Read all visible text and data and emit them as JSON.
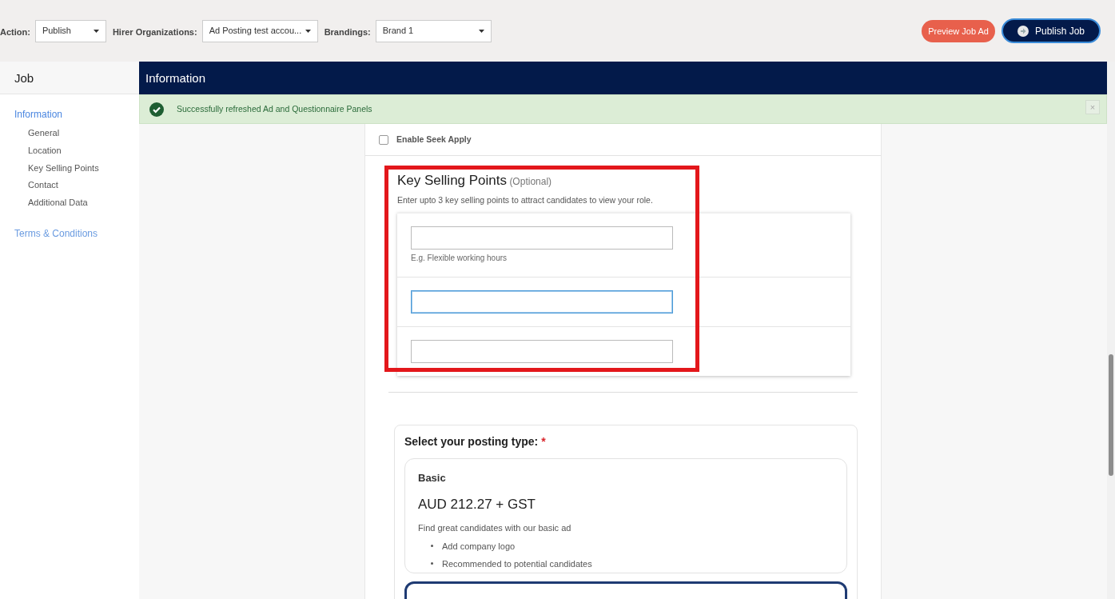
{
  "toolbar": {
    "fields": [
      {
        "label": "Action:",
        "value": "Publish"
      },
      {
        "label": "Hirer Organizations:",
        "value": "Ad Posting test accou..."
      },
      {
        "label": "Brandings:",
        "value": "Brand 1"
      }
    ],
    "buttons": [
      {
        "label": "Preview Job Ad",
        "kind": "secondary"
      },
      {
        "label": "Publish Job",
        "kind": "primary"
      }
    ]
  },
  "sidebar": {
    "title": "Job",
    "items": [
      {
        "label": "Information",
        "selected": true,
        "children": [
          {
            "label": "General"
          },
          {
            "label": "Location"
          },
          {
            "label": "Key Selling Points"
          },
          {
            "label": "Contact"
          },
          {
            "label": "Additional Data"
          }
        ]
      },
      {
        "label": "Terms & Conditions",
        "selected": false
      }
    ]
  },
  "header": {
    "title": "Information"
  },
  "alert": {
    "message": "Successfully refreshed Ad and Questionnaire Panels",
    "close": "×"
  },
  "seek_apply": {
    "label": "Enable Seek Apply",
    "checked": false
  },
  "key_selling_points": {
    "title": "Key Selling Points",
    "optional": "(Optional)",
    "description": "Enter upto 3 key selling points to attract candidates to view your role.",
    "highlighted": true,
    "fields": [
      {
        "hint": "E.g. Flexible working hours",
        "focused": false
      },
      {
        "focused": true
      },
      {
        "focused": false
      }
    ]
  },
  "posting_type": {
    "title": "Select your posting type:",
    "required": "*",
    "options": [
      {
        "name": "Basic",
        "price": "AUD 212.27 + GST",
        "description": "Find great candidates with our basic ad",
        "features": [
          "Add company logo",
          "Recommended to potential candidates"
        ],
        "selected": false
      },
      {
        "selected": true
      }
    ]
  }
}
